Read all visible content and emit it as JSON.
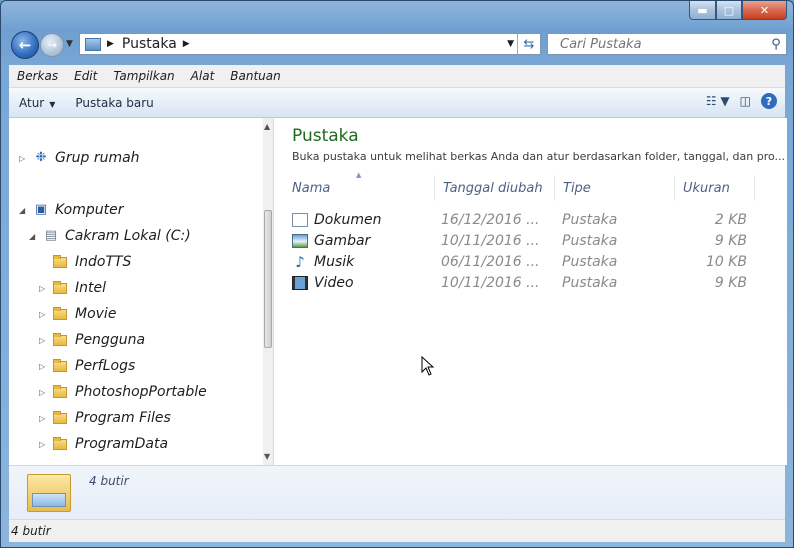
{
  "window": {
    "controls": {
      "minimize": "▬",
      "maximize": "□",
      "close": "✕"
    }
  },
  "nav": {
    "back_icon": "arrow-left-icon",
    "forward_icon": "arrow-right-icon"
  },
  "address": {
    "crumb": "Pustaka",
    "refresh_icon": "refresh-icon"
  },
  "search": {
    "placeholder": "Cari Pustaka"
  },
  "menu": [
    "Berkas",
    "Edit",
    "Tampilkan",
    "Alat",
    "Bantuan"
  ],
  "toolbar": {
    "organize": "Atur",
    "new_library": "Pustaka baru",
    "help": "?"
  },
  "tree": {
    "homegroup": "Grup rumah",
    "computer": "Komputer",
    "drive": "Cakram Lokal (C:)",
    "folders": [
      "IndoTTS",
      "Intel",
      "Movie",
      "Pengguna",
      "PerfLogs",
      "PhotoshopPortable",
      "Program Files",
      "ProgramData"
    ]
  },
  "library": {
    "title": "Pustaka",
    "subtitle": "Buka pustaka untuk melihat berkas Anda dan atur berdasarkan folder, tanggal, dan pro...",
    "columns": {
      "name": "Nama",
      "date": "Tanggal diubah",
      "type": "Tipe",
      "size": "Ukuran"
    },
    "rows": [
      {
        "name": "Dokumen",
        "date": "16/12/2016 ...",
        "type": "Pustaka",
        "size": "2 KB"
      },
      {
        "name": "Gambar",
        "date": "10/11/2016 ...",
        "type": "Pustaka",
        "size": "9 KB"
      },
      {
        "name": "Musik",
        "date": "06/11/2016 ...",
        "type": "Pustaka",
        "size": "10 KB"
      },
      {
        "name": "Video",
        "date": "10/11/2016 ...",
        "type": "Pustaka",
        "size": "9 KB"
      }
    ]
  },
  "details": {
    "count": "4 butir"
  },
  "status": {
    "count": "4 butir"
  }
}
